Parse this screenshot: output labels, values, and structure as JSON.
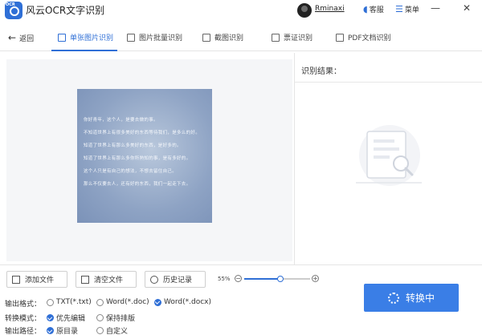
{
  "app": {
    "title": "风云OCR文字识别",
    "logo_text": "OCR"
  },
  "titlebar": {
    "username": "Rminaxi",
    "service_label": "客服",
    "menu_label": "菜单",
    "minimize": "—",
    "close": "✕"
  },
  "tabs": {
    "back_label": "返回",
    "items": [
      {
        "label": "单张图片识别",
        "active": true,
        "icon": "image-icon"
      },
      {
        "label": "图片批量识别",
        "active": false,
        "icon": "images-icon"
      },
      {
        "label": "截图识别",
        "active": false,
        "icon": "scissors-icon"
      },
      {
        "label": "票证识别",
        "active": false,
        "icon": "ticket-icon"
      },
      {
        "label": "PDF文档识别",
        "active": false,
        "icon": "pdf-icon"
      }
    ]
  },
  "document": {
    "lines": [
      "你好青年，这个人，是要去做的事。",
      "不知道世界上有很多美好的东西等待我们，是多么的好。",
      "知道了世界上有那么多美好的东西，是好多的。",
      "知道了世界上有那么多你所熟知的事，是有多好的。",
      "这个人只是有自己的想法，不想去留住自己。",
      "那么不仅要去人，还有好的东西，我们一起走下去。"
    ]
  },
  "results": {
    "title": "识别结果："
  },
  "controls": {
    "add_file": "添加文件",
    "clear_file": "清空文件",
    "history": "历史记录",
    "zoom_label": "55%",
    "zoom_value": 0.55
  },
  "options": {
    "output_format_label": "输出格式：",
    "formats": [
      {
        "label": "TXT(*.txt)",
        "selected": false
      },
      {
        "label": "Word(*.doc)",
        "selected": false
      },
      {
        "label": "Word(*.docx)",
        "selected": true
      }
    ],
    "convert_mode_label": "转换模式：",
    "modes": [
      {
        "label": "优先编辑",
        "selected": true
      },
      {
        "label": "保持排版",
        "selected": false
      }
    ],
    "output_path_label": "输出路径：",
    "paths": [
      {
        "label": "原目录",
        "selected": true
      },
      {
        "label": "自定义",
        "selected": false
      }
    ]
  },
  "convert_button": {
    "label": "转换中"
  },
  "colors": {
    "accent": "#2f6fd6",
    "button": "#3a7ee6"
  }
}
